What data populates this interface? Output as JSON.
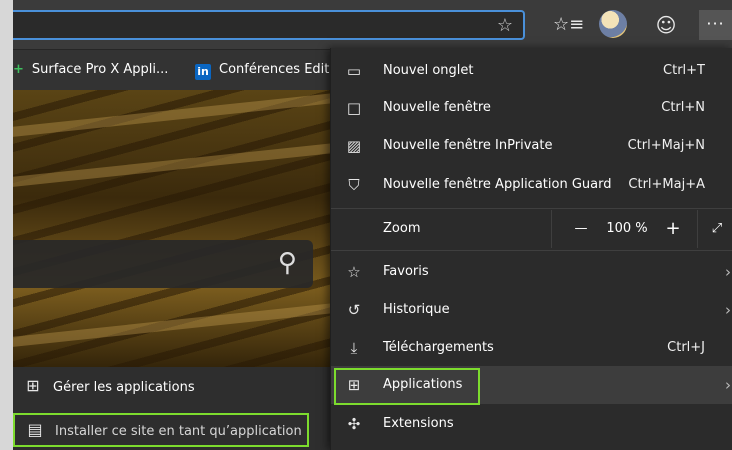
{
  "toolbar": {
    "star_icon": "☆",
    "favorites_icon": "☆≡",
    "smiley_icon": "☺",
    "more_label": "···"
  },
  "bookmarks": [
    {
      "icon": "+",
      "label": "Surface Pro X Appli..."
    },
    {
      "icon": "in",
      "label": "Conférences Editi"
    }
  ],
  "side_menu": {
    "manage_label": "Gérer les applications",
    "install_label": "Installer ce site en tant qu’application"
  },
  "menu": {
    "new_tab": {
      "label": "Nouvel onglet",
      "shortcut": "Ctrl+T"
    },
    "new_window": {
      "label": "Nouvelle fenêtre",
      "shortcut": "Ctrl+N"
    },
    "new_private": {
      "label": "Nouvelle fenêtre InPrivate",
      "shortcut": "Ctrl+Maj+N"
    },
    "new_guard": {
      "label": "Nouvelle fenêtre Application Guard",
      "shortcut": "Ctrl+Maj+A"
    },
    "zoom": {
      "label": "Zoom",
      "minus": "—",
      "value": "100 %",
      "plus": "+",
      "expand": "⤢"
    },
    "favorites": {
      "label": "Favoris"
    },
    "history": {
      "label": "Historique"
    },
    "downloads": {
      "label": "Téléchargements",
      "shortcut": "Ctrl+J"
    },
    "applications": {
      "label": "Applications"
    },
    "extensions": {
      "label": "Extensions"
    },
    "chevron": "›"
  },
  "colors": {
    "highlight_border": "#7ddc2e",
    "address_focus": "#4a90d9"
  }
}
